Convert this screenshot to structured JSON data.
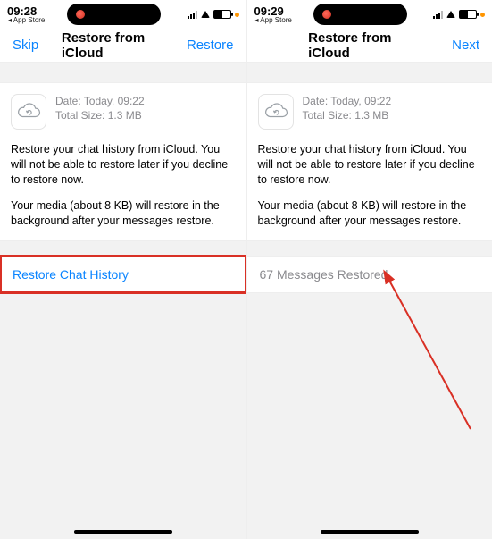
{
  "left": {
    "status": {
      "time": "09:28",
      "back_app": "App Store"
    },
    "nav": {
      "left": "Skip",
      "title": "Restore from iCloud",
      "right": "Restore"
    },
    "card": {
      "date_line": "Date: Today, 09:22",
      "size_line": "Total Size: 1.3 MB",
      "p1": "Restore your chat history from iCloud. You will not be able to restore later if you decline to restore now.",
      "p2": "Your media (about 8 KB) will restore in the background after your messages restore."
    },
    "action": {
      "label": "Restore Chat History"
    }
  },
  "right": {
    "status": {
      "time": "09:29",
      "back_app": "App Store"
    },
    "nav": {
      "left": "",
      "title": "Restore from iCloud",
      "right": "Next"
    },
    "card": {
      "date_line": "Date: Today, 09:22",
      "size_line": "Total Size: 1.3 MB",
      "p1": "Restore your chat history from iCloud. You will not be able to restore later if you decline to restore now.",
      "p2": "Your media (about 8 KB) will restore in the background after your messages restore."
    },
    "action": {
      "label": "67 Messages Restored"
    }
  },
  "colors": {
    "accent": "#0a84ff",
    "highlight": "#d93025"
  }
}
